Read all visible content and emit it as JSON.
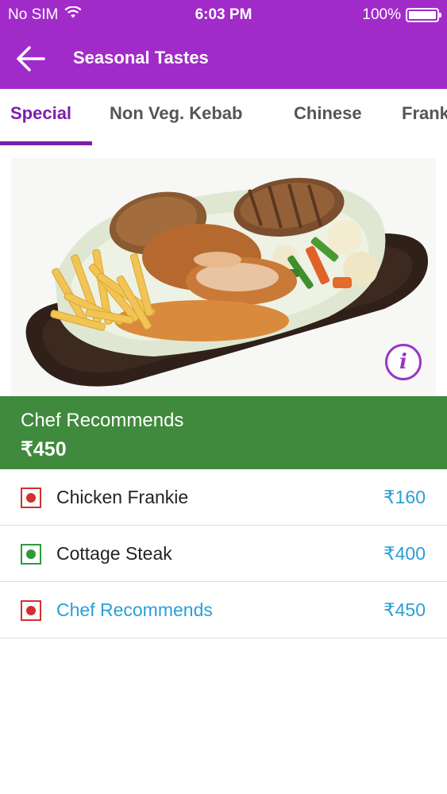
{
  "status_bar": {
    "carrier": "No SIM",
    "time": "6:03 PM",
    "battery": "100%"
  },
  "header": {
    "title": "Seasonal Tastes",
    "background_color": "#a12bc9"
  },
  "tabs": [
    {
      "label": "Special",
      "active": true
    },
    {
      "label": "Non Veg. Kebab",
      "active": false
    },
    {
      "label": "Chinese",
      "active": false
    },
    {
      "label": "Frankie",
      "active": false
    }
  ],
  "featured": {
    "name": "Chef Recommends",
    "price": "₹450",
    "banner_color": "#3f8a3c"
  },
  "menu_items": [
    {
      "name": "Chicken Frankie",
      "price": "₹160",
      "type": "non-veg",
      "selected": false
    },
    {
      "name": "Cottage Steak",
      "price": "₹400",
      "type": "veg",
      "selected": false
    },
    {
      "name": "Chef Recommends",
      "price": "₹450",
      "type": "non-veg",
      "selected": true
    }
  ],
  "colors": {
    "accent": "#7d1fa8",
    "price": "#2a9fd6",
    "veg": "#2e9a3a",
    "non_veg": "#d32f2f"
  }
}
